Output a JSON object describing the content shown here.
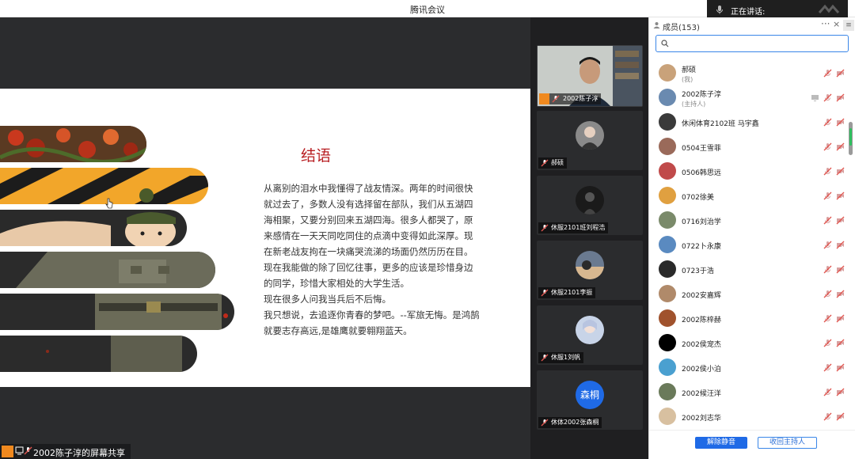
{
  "window": {
    "title": "腾讯会议"
  },
  "speaking": {
    "label": "正在讲话:"
  },
  "slide": {
    "title": "结语",
    "paragraphs": [
      "从离别的泪水中我懂得了战友情深。两年的时间很快就过去了，多数人没有选择留在部队，我们从五湖四海相聚，又要分别回来五湖四海。很多人都哭了，原来感情在一天天同吃同住的点滴中变得如此深厚。现在新老战友拘在一块痛哭流涕的场面仍然历历在目。现在我能做的除了回忆往事，更多的应该是珍惜身边的同学，珍惜大家相处的大学生活。",
      "现在很多人问我当兵后不后悔。",
      "我只想说，去追逐你青春的梦吧。--军旅无悔。是鸿鹄就要志存高远,是雄鹰就要翱翔蓝天。"
    ]
  },
  "share_label": "2002陈子淳的屏幕共享",
  "video_tiles": [
    {
      "name": "2002陈子淳"
    },
    {
      "name": "郝硕"
    },
    {
      "name": "休服2101班刘程浩"
    },
    {
      "name": "休服2101李振"
    },
    {
      "name": "休服1刘帆"
    },
    {
      "name": "休体2002张森桐",
      "avatar_text": "森桐"
    }
  ],
  "panel": {
    "title": "成员(153)",
    "more": "···",
    "close": "×",
    "menu": "≡",
    "search_value": "",
    "members": [
      {
        "name": "郝硕",
        "role": "(我)"
      },
      {
        "name": "2002陈子淳",
        "role": "(主持人)"
      },
      {
        "name": "休闲体育2102班 马宇鑫"
      },
      {
        "name": "0504王雪菲"
      },
      {
        "name": "0506韩思远"
      },
      {
        "name": "0702徐美"
      },
      {
        "name": "0716刘治学"
      },
      {
        "name": "0722卜永康"
      },
      {
        "name": "0723于浩"
      },
      {
        "name": "2002安嘉辉"
      },
      {
        "name": "2002陈梓赫"
      },
      {
        "name": "2002侯宠杰"
      },
      {
        "name": "2002侯小泊"
      },
      {
        "name": "2002候汪洋"
      },
      {
        "name": "2002刘志华"
      }
    ],
    "buttons": {
      "unmute_all": "解除静音",
      "reclaim_host": "收回主持人"
    }
  },
  "colors": {
    "accent": "#1f6ae6",
    "slide_title": "#b81e22",
    "muted_mic": "#e0554f"
  }
}
